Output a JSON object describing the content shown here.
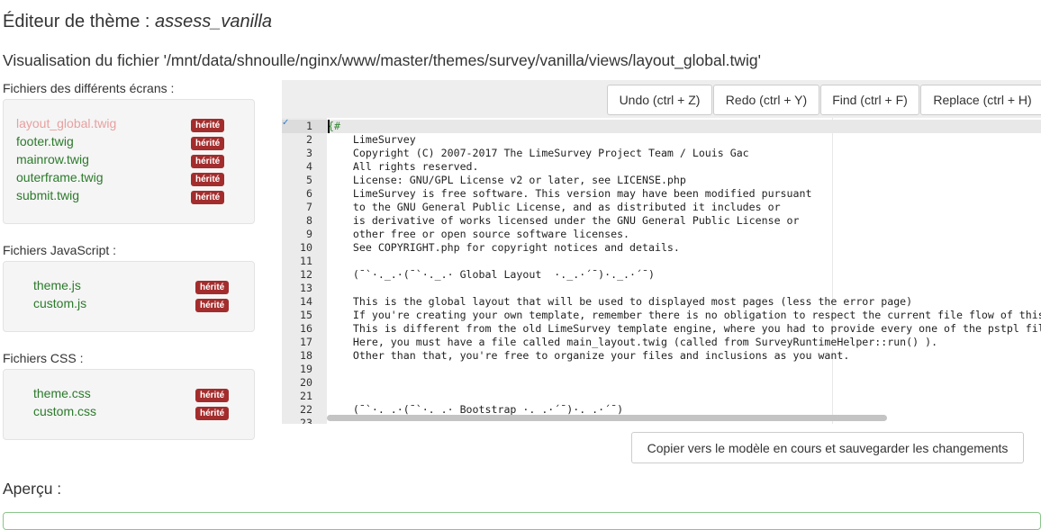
{
  "header": {
    "title_prefix": "Éditeur de thème : ",
    "theme_name": "assess_vanilla",
    "subtitle": "Visualisation du fichier '/mnt/data/shnoulle/nginx/www/master/themes/survey/vanilla/views/layout_global.twig'"
  },
  "screens": {
    "label": "Fichiers des différents écrans :",
    "files": [
      {
        "name": "layout_global.twig",
        "badge": "hérité"
      },
      {
        "name": "footer.twig",
        "badge": "hérité"
      },
      {
        "name": "mainrow.twig",
        "badge": "hérité"
      },
      {
        "name": "outerframe.twig",
        "badge": "hérité"
      },
      {
        "name": "submit.twig",
        "badge": "hérité"
      }
    ]
  },
  "js": {
    "label": "Fichiers JavaScript :",
    "files": [
      {
        "name": "theme.js",
        "badge": "hérité"
      },
      {
        "name": "custom.js",
        "badge": "hérité"
      }
    ]
  },
  "css": {
    "label": "Fichiers CSS :",
    "files": [
      {
        "name": "theme.css",
        "badge": "hérité"
      },
      {
        "name": "custom.css",
        "badge": "hérité"
      }
    ]
  },
  "toolbar": {
    "undo": "Undo (ctrl + Z)",
    "redo": "Redo (ctrl + Y)",
    "find": "Find (ctrl + F)",
    "replace": "Replace (ctrl + H)"
  },
  "code": {
    "lines": [
      "{#",
      "    LimeSurvey",
      "    Copyright (C) 2007-2017 The LimeSurvey Project Team / Louis Gac",
      "    All rights reserved.",
      "    License: GNU/GPL License v2 or later, see LICENSE.php",
      "    LimeSurvey is free software. This version may have been modified pursuant",
      "    to the GNU General Public License, and as distributed it includes or",
      "    is derivative of works licensed under the GNU General Public License or",
      "    other free or open source software licenses.",
      "    See COPYRIGHT.php for copyright notices and details.",
      "",
      "    (¯`·._.·(¯`·._.· Global Layout  ·._.·´¯)·._.·´¯)",
      "",
      "    This is the global layout that will be used to displayed most pages (less the error page)",
      "    If you're creating your own template, remember there is no obligation to respect the current file flow of this",
      "    This is different from the old LimeSurvey template engine, where you had to provide every one of the pstpl files",
      "    Here, you must have a file called main_layout.twig (called from SurveyRuntimeHelper::run() ).",
      "    Other than that, you're free to organize your files and inclusions as you want.",
      "",
      "",
      "",
      "    (¯`·._.·(¯`·._.· Bootstrap ·._.·´¯)·._.·´¯)",
      ""
    ]
  },
  "save_label": "Copier vers le modèle en cours et sauvegarder les changements",
  "preview_label": "Aperçu :"
}
